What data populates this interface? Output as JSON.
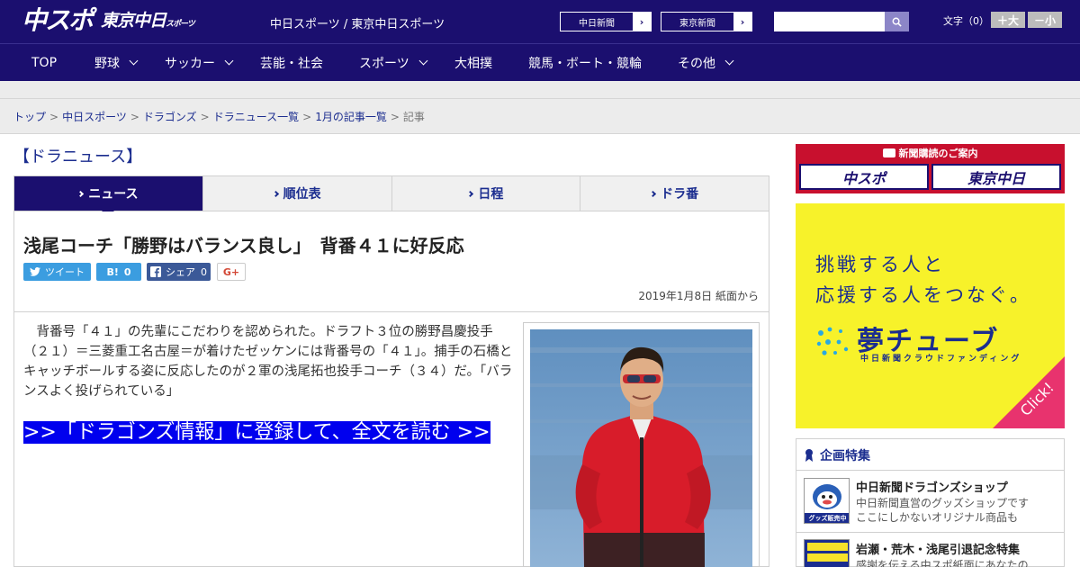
{
  "header": {
    "logo_main": "中スポ",
    "logo_sub": "東京中日",
    "logo_sub_small": "スポーツ",
    "site_title": "中日スポーツ / 東京中日スポーツ",
    "paper_links": [
      {
        "label": "中日新聞",
        "arrow": "›"
      },
      {
        "label": "東京新聞",
        "arrow": "›"
      }
    ],
    "search_placeholder": "",
    "font_size_label": "文字（0）",
    "font_bigger": "＋大",
    "font_smaller": "－小"
  },
  "nav": {
    "items": [
      {
        "label": "TOP"
      },
      {
        "label": "野球"
      },
      {
        "label": "サッカー"
      },
      {
        "label": "芸能・社会"
      },
      {
        "label": "スポーツ"
      },
      {
        "label": "大相撲"
      },
      {
        "label": "競馬・ボート・競輪"
      },
      {
        "label": "その他"
      }
    ]
  },
  "breadcrumb": {
    "items": [
      "トップ",
      "中日スポーツ",
      "ドラゴンズ",
      "ドラニュース一覧",
      "1月の記事一覧"
    ],
    "current": "記事",
    "separator": ">"
  },
  "section_title": "【ドラニュース】",
  "tabs": [
    {
      "label": "ニュース"
    },
    {
      "label": "順位表"
    },
    {
      "label": "日程"
    },
    {
      "label": "ドラ番"
    }
  ],
  "article": {
    "headline": "浅尾コーチ「勝野はバランス良し」　背番４１に好反応",
    "share": {
      "tweet": "ツイート",
      "hatena": "B!",
      "hatena_count": "0",
      "facebook": "シェア",
      "facebook_count": "0",
      "gplus": "G+"
    },
    "dateline": "2019年1月8日 紙面から",
    "body": "背番号「４１」の先輩にこだわりを認められた。ドラフト３位の勝野昌慶投手（２１）＝三菱重工名古屋＝が着けたゼッケンには背番号の「４１」。捕手の石橋とキャッチボールする姿に反応したのが２軍の浅尾拓也投手コーチ（３４）だ。「バランスよく投げられている」",
    "read_more": ">>「ドラゴンズ情報」に登録して、全文を読む >>"
  },
  "sidebar": {
    "subscribe": {
      "title": "新聞購読のご案内",
      "btn1": "中スポ",
      "btn2": "東京中日"
    },
    "yume_ad": {
      "line1": "挑戦する人と",
      "line2": "応援する人をつなぐ。",
      "brand": "夢チューブ",
      "sub": "中日新聞クラウドファンディング",
      "click": "Click!"
    },
    "feature": {
      "heading": "企画特集",
      "items": [
        {
          "title": "中日新聞ドラゴンズショップ",
          "desc1": "中日新聞直営のグッズショップです",
          "desc2": "ここにしかないオリジナル商品も",
          "badge": "グッズ販売中"
        },
        {
          "title": "岩瀬・荒木・浅尾引退記念特集",
          "desc1": "感謝を伝える中スポ紙面にあなたの",
          "desc2": ""
        }
      ]
    }
  },
  "colors": {
    "brand_navy": "#1b0f6f",
    "link_blue": "#1b2d8f",
    "subscribe_red": "#c8102e",
    "ad_yellow": "#f7f22a",
    "click_pink": "#e8336e",
    "read_more_bg": "#0000ee"
  }
}
